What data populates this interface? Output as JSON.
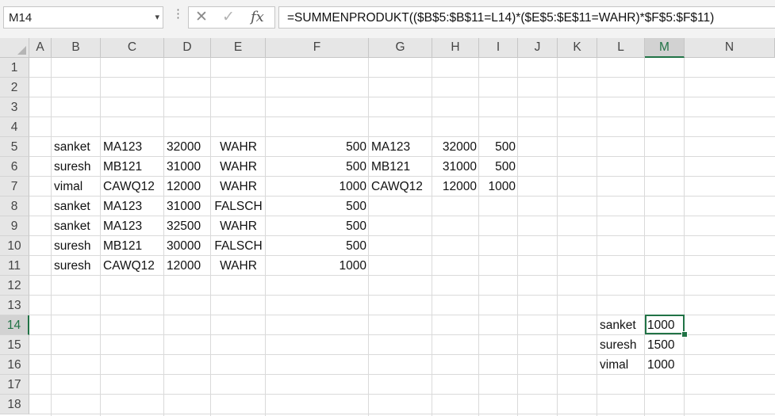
{
  "formula_bar": {
    "name_box": "M14",
    "name_box_arrow": "▾",
    "options_dots": "⋮",
    "cancel_glyph": "✕",
    "enter_glyph": "✓",
    "fx_glyph": "fx",
    "formula": "=SUMMENPRODUKT(($B$5:$B$11=L14)*($E$5:$E$11=WAHR)*$F$5:$F$11)"
  },
  "columns": [
    "A",
    "B",
    "C",
    "D",
    "E",
    "F",
    "G",
    "H",
    "I",
    "J",
    "K",
    "L",
    "M",
    "N"
  ],
  "rows": [
    "1",
    "2",
    "3",
    "4",
    "5",
    "6",
    "7",
    "8",
    "9",
    "10",
    "11",
    "12",
    "13",
    "14",
    "15",
    "16",
    "17",
    "18"
  ],
  "selected_column": "M",
  "selected_row": "14",
  "table_main": [
    [
      "sanket",
      "MA123",
      "32000",
      "WAHR",
      "500"
    ],
    [
      "suresh",
      "MB121",
      "31000",
      "WAHR",
      "500"
    ],
    [
      "vimal",
      "CAWQ12",
      "12000",
      "WAHR",
      "1000"
    ],
    [
      "sanket",
      "MA123",
      "31000",
      "FALSCH",
      "500"
    ],
    [
      "sanket",
      "MA123",
      "32500",
      "WAHR",
      "500"
    ],
    [
      "suresh",
      "MB121",
      "30000",
      "FALSCH",
      "500"
    ],
    [
      "suresh",
      "CAWQ12",
      "12000",
      "WAHR",
      "1000"
    ]
  ],
  "table_side": [
    [
      "MA123",
      "32000",
      "500"
    ],
    [
      "MB121",
      "31000",
      "500"
    ],
    [
      "CAWQ12",
      "12000",
      "1000"
    ]
  ],
  "summary": [
    [
      "sanket",
      "1000"
    ],
    [
      "suresh",
      "1500"
    ],
    [
      "vimal",
      "1000"
    ]
  ],
  "colors": {
    "accent": "#217346",
    "header_bg": "#e6e6e6",
    "gridline": "#dadada"
  }
}
